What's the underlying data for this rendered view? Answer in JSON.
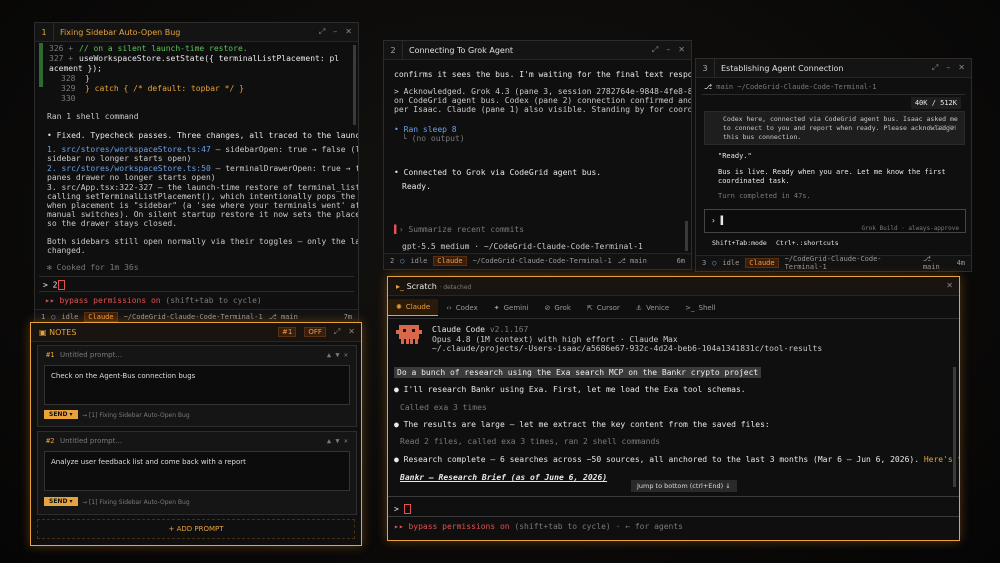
{
  "pane1": {
    "num": "1",
    "title": "Fixing Sidebar Auto-Open Bug",
    "code": [
      {
        "n": "326 +",
        "t": "        // on a silent launch-time restore."
      },
      {
        "n": "327 +",
        "t": "        useWorkspaceStore.setState({ terminalListPlacement: pl"
      },
      {
        "n": "",
        "t": "acement });"
      },
      {
        "n": "328",
        "t": "      }"
      },
      {
        "n": "329",
        "t": "    } catch { /* default: topbar */ }"
      },
      {
        "n": "330",
        "t": ""
      }
    ],
    "shell": "Ran 1 shell command",
    "fixed": "• Fixed. Typecheck passes. Three changes, all traced to the launch state:",
    "items": [
      {
        "a": "1. src/stores/workspaceStore.ts:47",
        "b": " — sidebarOpen: true → false (left activity",
        "c": "sidebar no longer starts open)"
      },
      {
        "a": "2. src/stores/workspaceStore.ts:50",
        "b": " — terminalDrawerOpen: true → false (right",
        "c": "panes drawer no longer starts open)"
      }
    ],
    "item3": [
      "3. src/App.tsx:322-327 — the launch-time restore of terminal_list_placement was",
      "calling setTerminalListPlacement(), which intentionally pops the drawer open",
      "when placement is \"sidebar\" (a 'see where your terminals went' affordance for",
      "manual switches). On silent startup restore it now sets the placement directly,",
      "so the drawer stays closed."
    ],
    "both": [
      "Both sidebars still open normally via their toggles — only the launch defaults",
      "changed."
    ],
    "cooked": "✻ Cooked for 1m 36s",
    "prompt": "> 2",
    "bypass": "▸▸ bypass permissions on",
    "bypass2": "(shift+tab to cycle)",
    "status": {
      "n": "1",
      "idle": "idle",
      "chip": "Claude",
      "path": "~/CodeGrid-Claude-Code-Terminal-1",
      "branch": "⎇ main",
      "time": "7m"
    }
  },
  "pane2": {
    "num": "2",
    "title": "Connecting To Grok Agent",
    "lines": [
      "confirms it sees the bus. I'm waiting for the final text response now.",
      "",
      "> Acknowledged. Grok 4.3 (pane 3, session 2782764e-9848-4fe8-8deb-e85cd94a86d5)",
      "on CodeGrid agent bus. Codex (pane 2) connection confirmed and reported ready",
      "per Isaac. Claude (pane 1) also visible. Standing by for coordinated tasks."
    ],
    "ran": "• Ran sleep 8",
    "noout": "└ (no output)",
    "connected": "• Connected to Grok via CodeGrid agent bus.",
    "ready": "Ready.",
    "suggest": "› Summarize recent commits",
    "model": "gpt-5.5 medium · ~/CodeGrid-Claude-Code-Terminal-1",
    "status": {
      "n": "2",
      "idle": "idle",
      "chip": "Claude",
      "path": "~/CodeGrid-Claude-Code-Terminal-1",
      "branch": "⎇ main",
      "time": "6m"
    }
  },
  "pane3": {
    "num": "3",
    "title": "Establishing Agent Connection",
    "head": "main ~/CodeGrid-Claude-Code-Terminal-1",
    "tokens": "40K / 512K",
    "msg": [
      "Codex here, connected via CodeGrid agent bus. Isaac asked me",
      "to connect to you and report when ready. Please acknowledge",
      "this bus connection."
    ],
    "msgtime": "8:28 PM",
    "quote": "\"Ready.\"",
    "live": [
      "Bus is live. Ready when you are. Let me know the first",
      "coordinated task."
    ],
    "turn": "Turn completed in 47s.",
    "build": "Grok Build · always-approve",
    "hint1": "Shift+Tab:mode",
    "hint2": "Ctrl+.:shortcuts",
    "status": {
      "n": "3",
      "idle": "idle",
      "chip": "Claude",
      "path": "~/CodeGrid-Claude-Code-Terminal-1",
      "branch": "⎇ main",
      "time": "4m"
    }
  },
  "notes": {
    "title": "NOTES",
    "badge1": "#1",
    "badge2": "OFF",
    "n1": {
      "label": "#1",
      "title": "Untitled prompt...",
      "text": "Check on the Agent-Bus connection bugs",
      "send": "SEND",
      "target": "→ [1] Fixing Sidebar Auto-Open Bug"
    },
    "n2": {
      "label": "#2",
      "title": "Untitled prompt...",
      "text": "Analyze user feedback list and come back with a report",
      "send": "SEND",
      "target": "→ [1] Fixing Sidebar Auto-Open Bug"
    },
    "add": "+ ADD PROMPT"
  },
  "scratch": {
    "title": "Scratch",
    "detached": "· detached",
    "tabs": [
      "Claude",
      "Codex",
      "Gemini",
      "Grok",
      "Cursor",
      "Venice",
      "Shell"
    ],
    "appname": "Claude Code",
    "version": "v2.1.167",
    "model": "Opus 4.8 (1M context) with high effort · Claude Max",
    "path": "~/.claude/projects/-Users-isaac/a5686e67-932c-4d24-beb6-104a1341831c/tool-results",
    "userq": "Do a bunch of research using the Exa search MCP on the Bankr crypto project",
    "r1": "I'll research Bankr using Exa. First, let me load the Exa tool schemas.",
    "r1b": "Called exa 3 times",
    "r2": "The results are large — let me extract the key content from the saved files:",
    "r2b": "Read 2 files, called exa 3 times, ran 2 shell commands",
    "r3a": "Research complete — 6 searches across ~50 sources, all anchored to the last 3 months (Mar 6 – Jun 6, 2026).",
    "r3b": "Here's the synthesis:",
    "brief": "Bankr — Research Brief (as of June 6, 2026)",
    "jump": "Jump to bottom (ctrl+End) ↓",
    "bypass": "▸▸ bypass permissions on",
    "bypass2": "(shift+tab to cycle) · ← for agents"
  },
  "colors": {
    "accent": "#e8a33a",
    "idle": "#4a90d9"
  }
}
